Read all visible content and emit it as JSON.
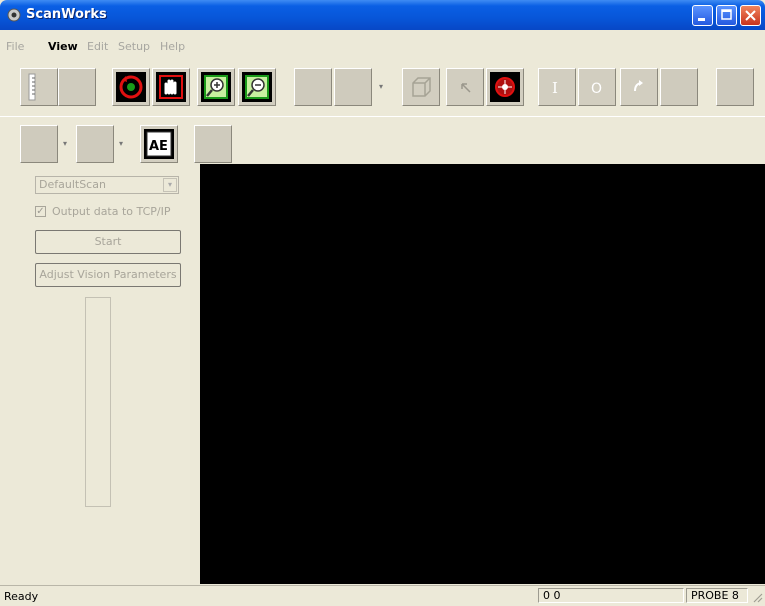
{
  "window": {
    "title": "ScanWorks"
  },
  "menu": {
    "items": [
      "File",
      "View",
      "Edit",
      "Setup",
      "Help"
    ]
  },
  "toolbar": {
    "top_icons": [
      "ruler-icon",
      "blank",
      "rotate-view-icon",
      "pan-hand-icon",
      "zoom-in-icon",
      "zoom-out-icon",
      "blank",
      "blank",
      "cube-icon",
      "select-arrow-icon",
      "target-icon",
      "io-i-icon",
      "io-o-icon",
      "curve-arrow-icon",
      "blank",
      "blank"
    ],
    "second_row": [
      "blank",
      "blank",
      "ae-icon",
      "blank"
    ],
    "ae_label": "AE"
  },
  "left_panel": {
    "scan_select_value": "DefaultScan",
    "tcp_label": "Output data to TCP/IP",
    "tcp_checked": true,
    "start_label": "Start",
    "vision_label": "Adjust Vision Parameters"
  },
  "status": {
    "ready": "Ready",
    "coords": "0  0",
    "probe": "PROBE 8"
  },
  "colors": {
    "titlebar": "#0756d9",
    "viewport": "#000000",
    "icon_red": "#e01010",
    "icon_green": "#1a9a1a"
  }
}
